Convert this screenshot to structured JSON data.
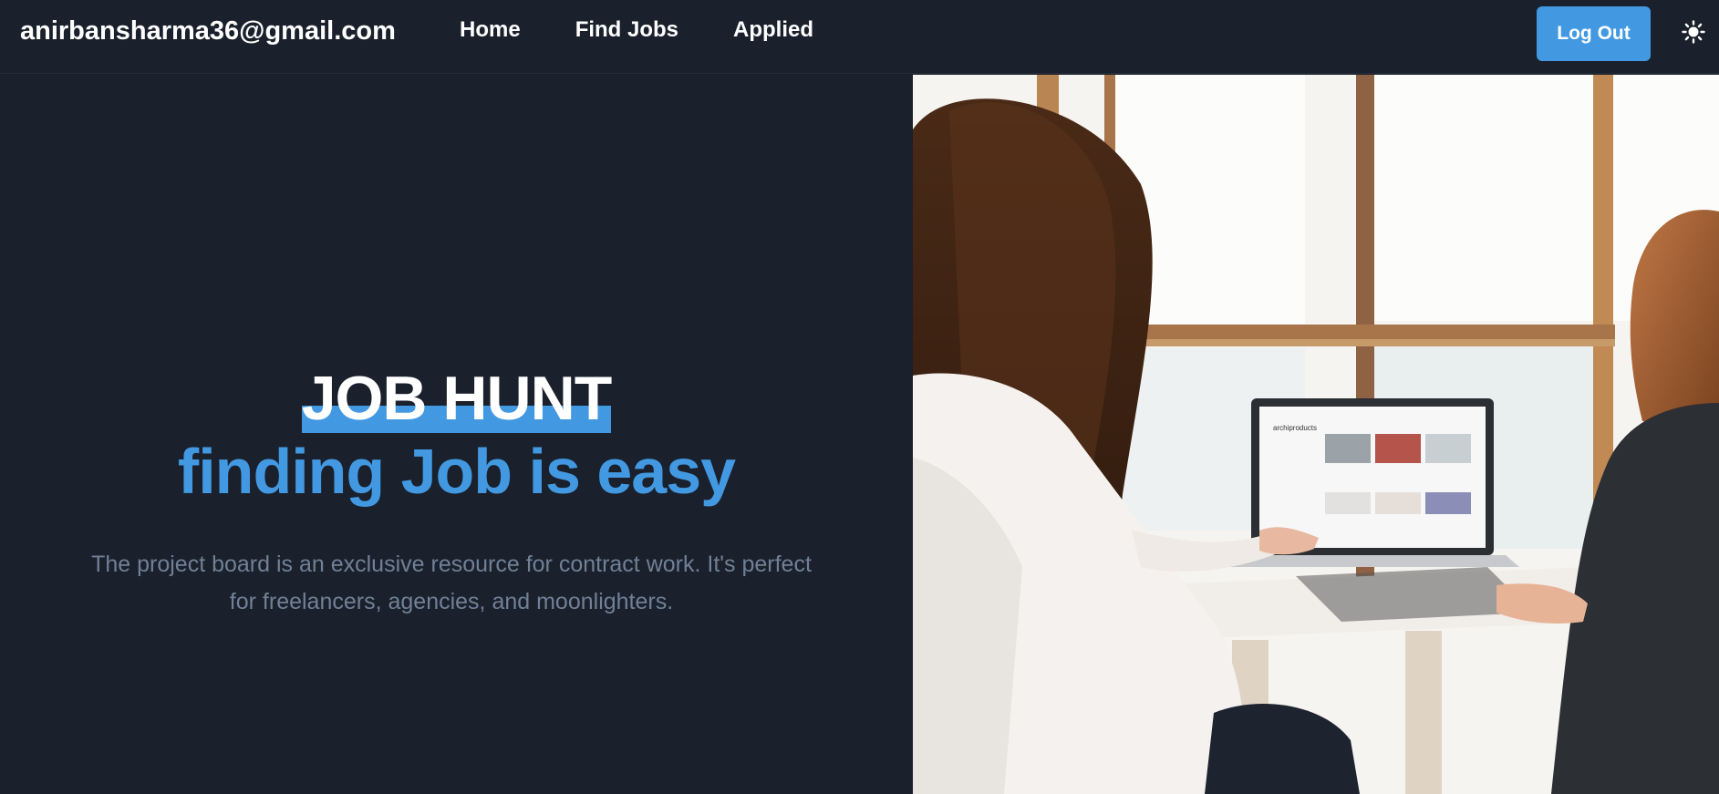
{
  "navbar": {
    "brand": "anirbansharma36@gmail.com",
    "links": [
      "Home",
      "Find Jobs",
      "Applied"
    ],
    "logout_label": "Log Out",
    "theme_icon": "sun-icon"
  },
  "hero": {
    "title_main": "JOB HUNT",
    "title_sub": "finding Job is easy",
    "description": "The project board is an exclusive resource for contract work. It's perfect for freelancers, agencies, and moonlighters."
  },
  "image": {
    "laptop_screen_text": "archiproducts"
  },
  "colors": {
    "background": "#1a202c",
    "accent": "#4299e1",
    "muted_text": "#718096"
  }
}
